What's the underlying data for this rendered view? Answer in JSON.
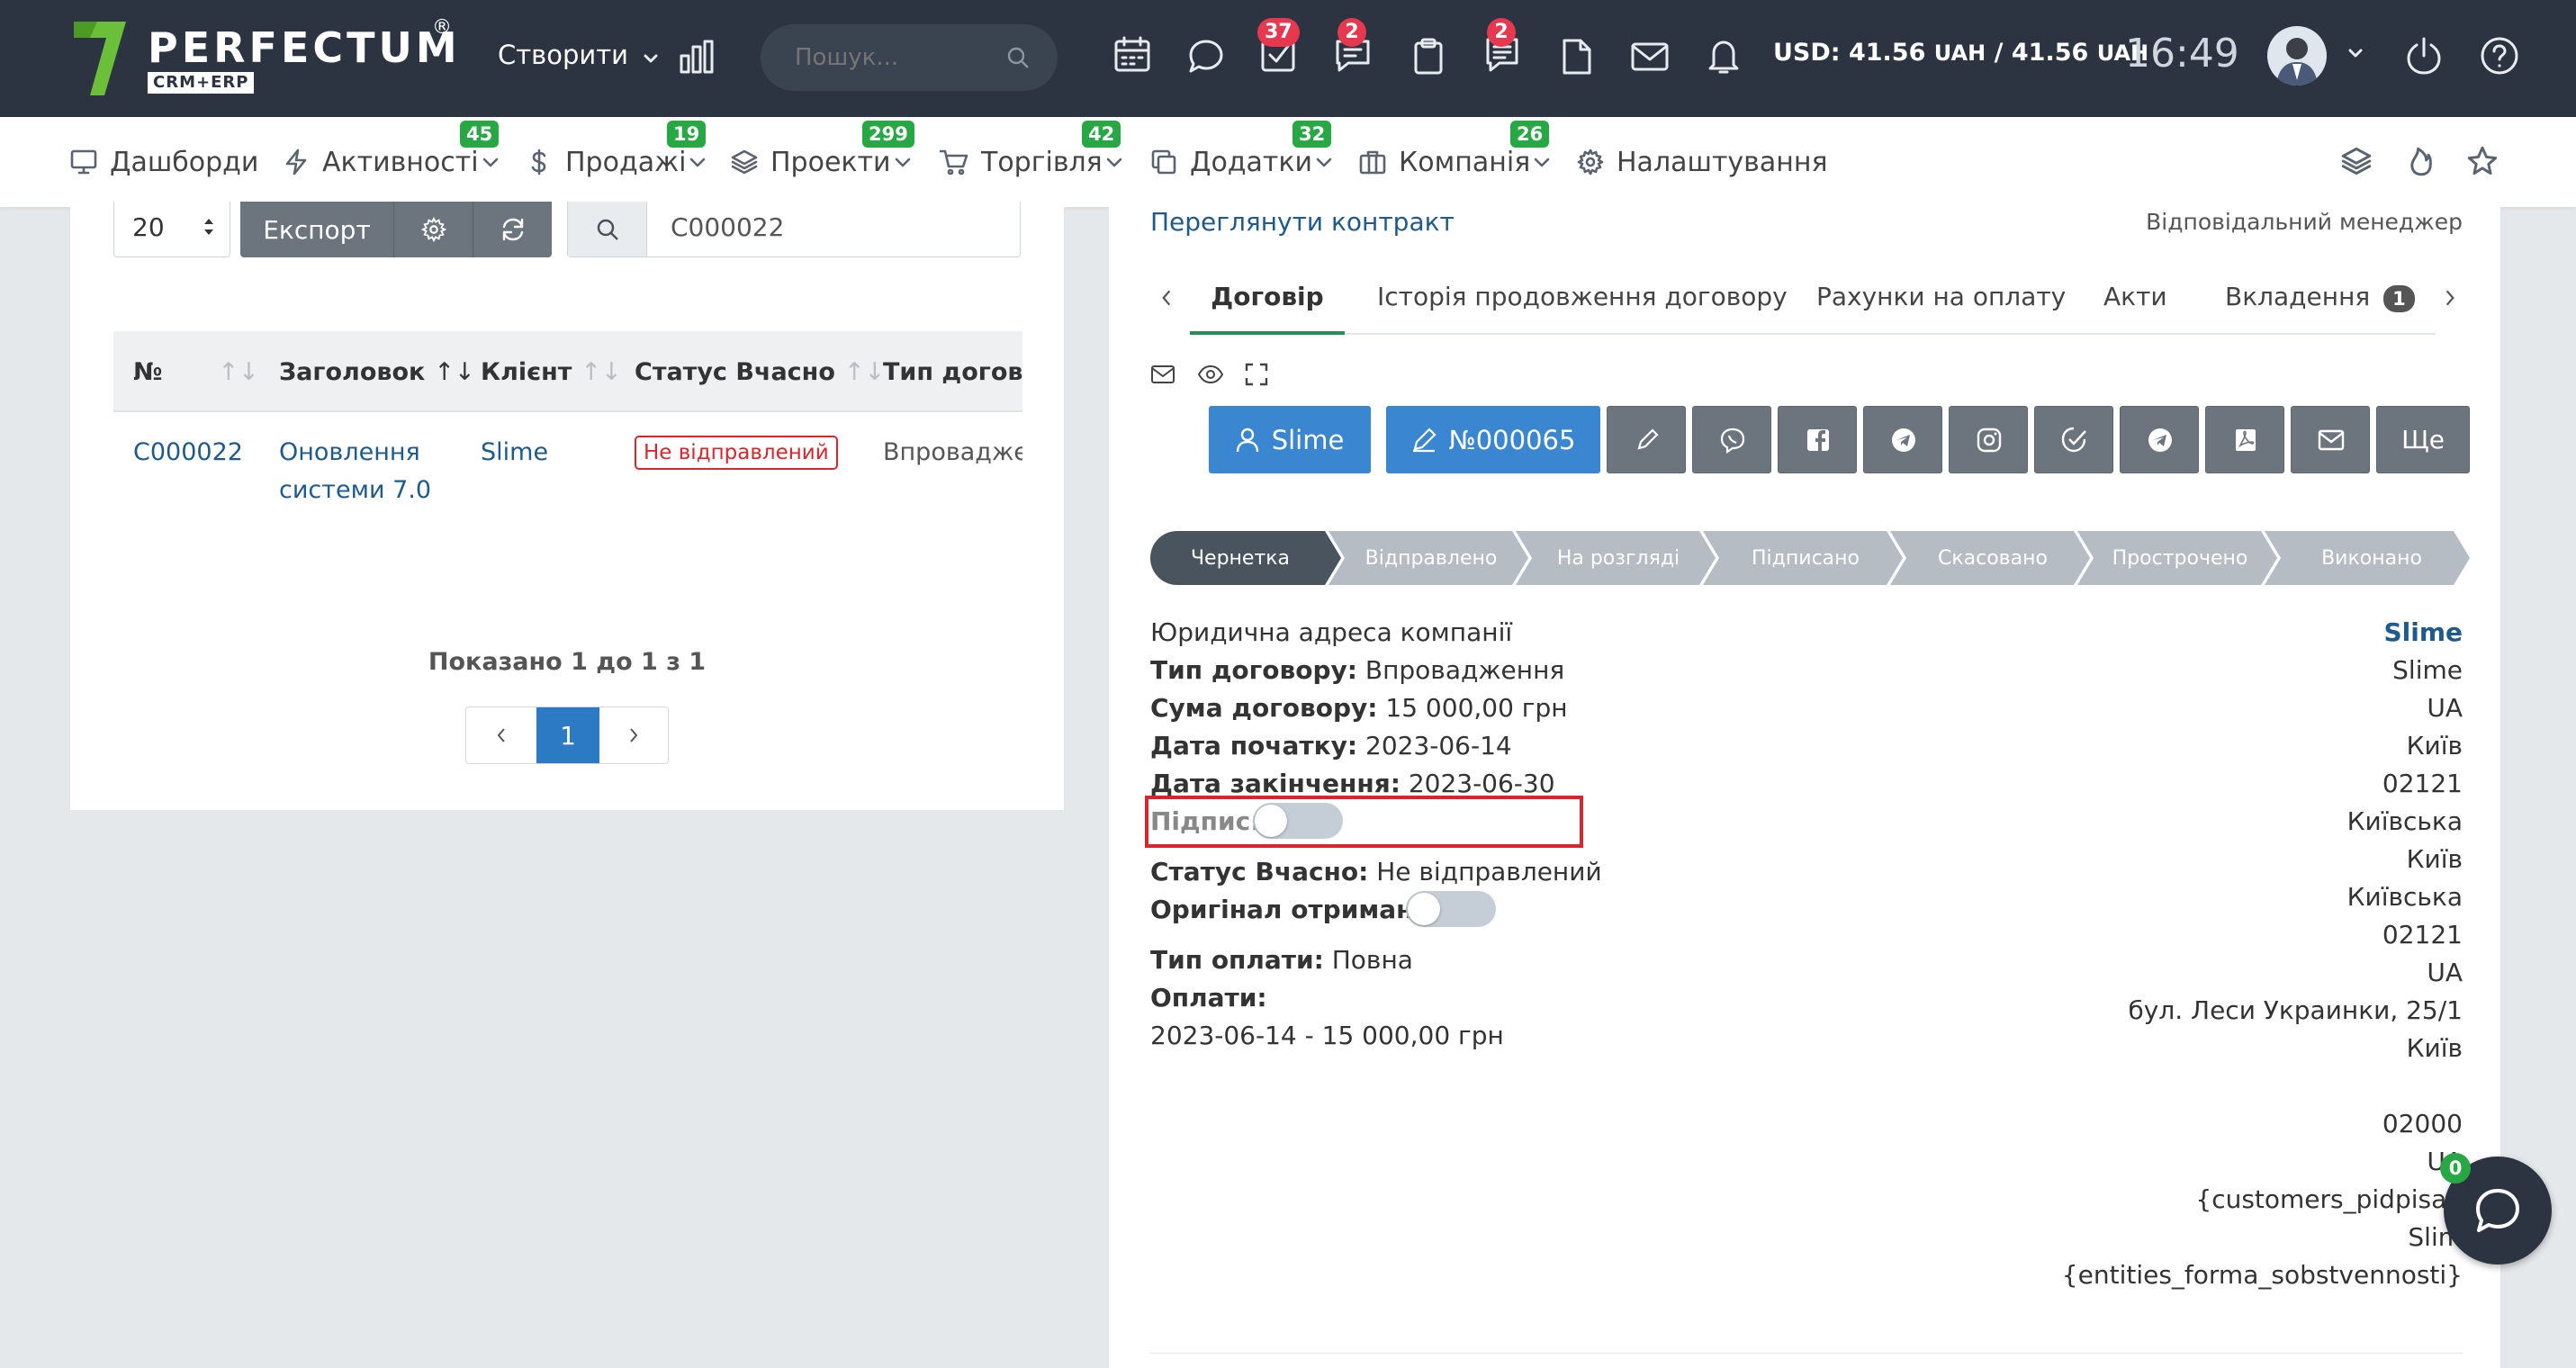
{
  "topbar": {
    "logo_text": "PERFECTUM",
    "logo_reg": "®",
    "logo_sub": "CRM+ERP",
    "create_label": "Створити",
    "search_placeholder": "Пошук...",
    "badges": {
      "tasks": "37",
      "chat": "2",
      "notes": "2"
    },
    "currency": "USD: 41.56",
    "currency_unit1": "UAH",
    "currency_sep": "/ 41.56",
    "currency_unit2": "UAH",
    "time": "16:49"
  },
  "nav": {
    "items": [
      {
        "label": "Дашборди",
        "icon": "monitor-icon"
      },
      {
        "label": "Активності",
        "badge": "45",
        "icon": "lightning-icon"
      },
      {
        "label": "Продажі",
        "badge": "19",
        "icon": "dollar-icon"
      },
      {
        "label": "Проекти",
        "badge": "299",
        "icon": "layers-icon"
      },
      {
        "label": "Торгівля",
        "badge": "42",
        "icon": "cart-icon"
      },
      {
        "label": "Додатки",
        "badge": "32",
        "icon": "copy-icon"
      },
      {
        "label": "Компанія",
        "badge": "26",
        "icon": "briefcase-icon"
      },
      {
        "label": "Налаштування",
        "icon": "gear-icon"
      }
    ]
  },
  "list": {
    "per_page": "20",
    "export_label": "Експорт",
    "search_value": "C000022",
    "columns": [
      "№",
      "Заголовок",
      "Клієнт",
      "Статус Вчасно",
      "Тип договор"
    ],
    "rows": [
      {
        "number": "C000022",
        "title_line1": "Оновлення",
        "title_line2": "системи 7.0",
        "client": "Slime",
        "status": "Не відправлений",
        "type": "Впроваджен"
      }
    ],
    "shown": "Показано 1 до 1 з 1",
    "page": "1"
  },
  "detail": {
    "view_contract": "Переглянути контракт",
    "manager": "Відповідальний менеджер",
    "tabs": [
      "Договір",
      "Історія продовження договору",
      "Рахунки на оплату",
      "Акти",
      "Вкладення"
    ],
    "attachments_count": "1",
    "client_button": "Slime",
    "number_button": "№000065",
    "more_label": "Ще",
    "stages": [
      "Чернетка",
      "Відправлено",
      "На розгляді",
      "Підписано",
      "Скасовано",
      "Прострочено",
      "Виконано"
    ],
    "company_address": "Юридична адреса компанії",
    "type_label": "Тип договору:",
    "type_value": "Впровадження",
    "sum_label": "Сума договору:",
    "sum_value": "15 000,00 грн",
    "start_label": "Дата початку:",
    "start_value": "2023-06-14",
    "end_label": "Дата закінчення:",
    "end_value": "2023-06-30",
    "sign_label": "Підпис:",
    "status_label": "Статус Вчасно:",
    "status_value": "Не відправлений",
    "original_label": "Оригінал отримано:",
    "payment_type_label": "Тип оплати:",
    "payment_type_value": "Повна",
    "payments_label": "Оплати:",
    "payment_entry": "2023-06-14 - 15 000,00 грн",
    "right_col": [
      "Slime",
      "Slime",
      "UA",
      "Київ",
      "02121",
      "Київська",
      "Київ",
      "Київська",
      "02121",
      "UA",
      "бул. Леси Украинки, 25/1",
      "Київ",
      "",
      "02000",
      "UA",
      "{customers_pidpisan",
      "Slim",
      "{entities_forma_sobstvennosti}"
    ]
  },
  "chat": {
    "badge": "0"
  },
  "colors": {
    "topbar": "#2b3440",
    "accent_blue": "#3a86d0",
    "green_badge": "#28a745",
    "red_badge": "#e6394f",
    "highlight_box": "#d9262c"
  }
}
